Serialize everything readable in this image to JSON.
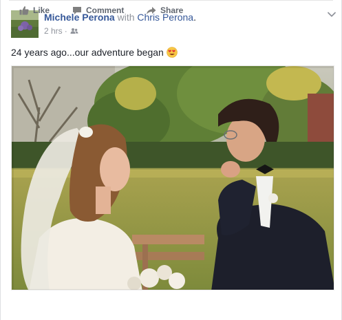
{
  "post": {
    "author": "Michele Perona",
    "with_text": "with",
    "tagged": "Chris Perona",
    "period": ".",
    "time": "2 hrs",
    "separator": "·",
    "audience_icon": "friends-icon",
    "text": "24 years ago...our adventure began",
    "emoji": "heart-eyes-emoji"
  },
  "actions": {
    "like_label": "Like",
    "comment_label": "Comment",
    "share_label": "Share"
  },
  "colors": {
    "link": "#365899",
    "meta": "#90949c",
    "action": "#616770"
  }
}
